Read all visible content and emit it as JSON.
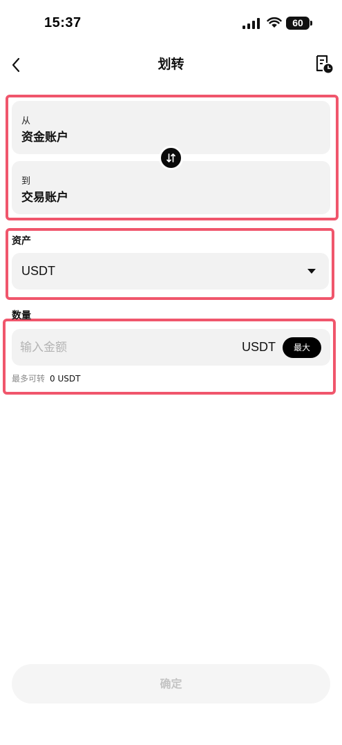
{
  "status_bar": {
    "time": "15:37",
    "battery_level": "60",
    "icons": [
      "signal-icon",
      "wifi-icon",
      "battery-icon"
    ]
  },
  "nav": {
    "title": "划转",
    "back_icon": "chevron-left-icon",
    "history_icon": "history-icon"
  },
  "transfer": {
    "from_label": "从",
    "from_account": "资金账户",
    "to_label": "到",
    "to_account": "交易账户",
    "swap_icon": "swap-arrows-icon"
  },
  "asset": {
    "label": "资产",
    "selected": "USDT"
  },
  "amount": {
    "label": "数量",
    "placeholder": "输入金额",
    "value": "",
    "unit": "USDT",
    "max_label": "最大",
    "max_transfer_label": "最多可转",
    "max_transfer_value": "0 USDT"
  },
  "footer": {
    "confirm_label": "确定"
  },
  "colors": {
    "highlight": "#f0566c",
    "field_bg": "#f2f2f2",
    "confirm_disabled_bg": "#f5f5f5",
    "confirm_disabled_text": "#c4c4c4"
  }
}
